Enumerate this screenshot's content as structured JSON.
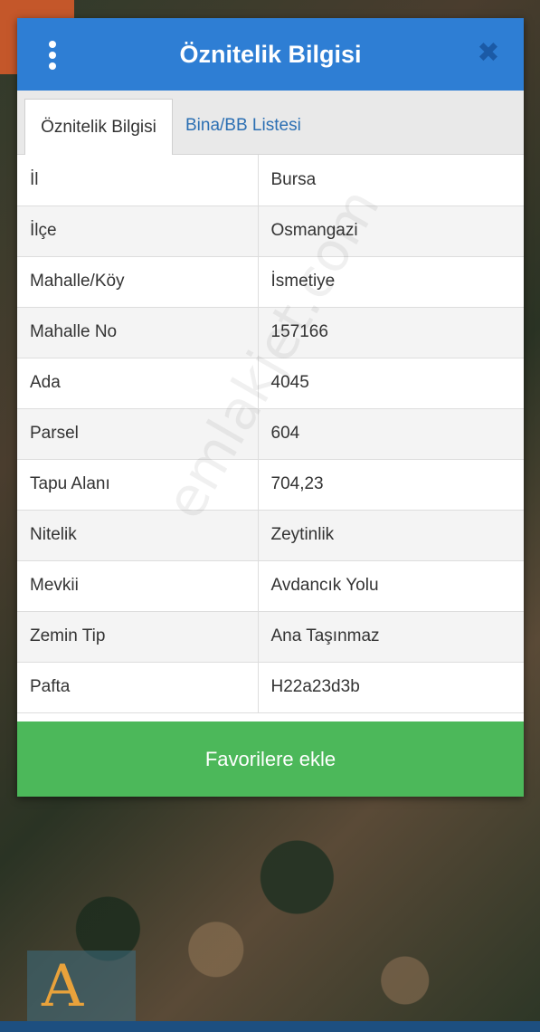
{
  "dialog": {
    "title": "Öznitelik Bilgisi",
    "favorite_button_label": "Favorilere ekle"
  },
  "tabs": [
    {
      "label": "Öznitelik Bilgisi",
      "active": true
    },
    {
      "label": "Bina/BB Listesi",
      "active": false
    }
  ],
  "attributes": [
    {
      "key": "İl",
      "value": "Bursa"
    },
    {
      "key": "İlçe",
      "value": "Osmangazi"
    },
    {
      "key": "Mahalle/Köy",
      "value": "İsmetiye"
    },
    {
      "key": "Mahalle No",
      "value": "157166"
    },
    {
      "key": "Ada",
      "value": "4045"
    },
    {
      "key": "Parsel",
      "value": "604"
    },
    {
      "key": "Tapu Alanı",
      "value": "704,23"
    },
    {
      "key": "Nitelik",
      "value": "Zeytinlik"
    },
    {
      "key": "Mevkii",
      "value": "Avdancık Yolu"
    },
    {
      "key": "Zemin Tip",
      "value": "Ana Taşınmaz"
    },
    {
      "key": "Pafta",
      "value": "H22a23d3b"
    }
  ],
  "watermark": "emlakjet.com",
  "icons": {
    "menu": "more-vertical-icon",
    "close": "close-icon"
  },
  "colors": {
    "header": "#2e7ed4",
    "close_icon": "#1b5aa6",
    "tab_link": "#2b6fb3",
    "favorite_button": "#4cb85a"
  }
}
